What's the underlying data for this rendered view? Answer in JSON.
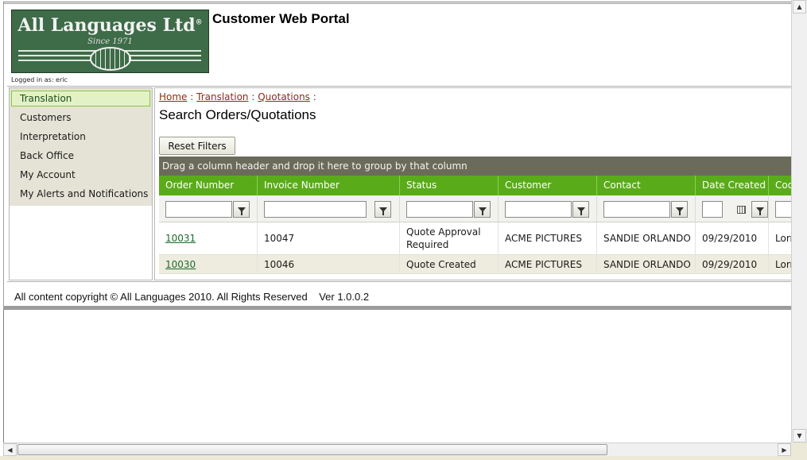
{
  "header": {
    "logo_text": "All Languages Ltd",
    "logo_registered": "®",
    "logo_since": "Since 1971",
    "portal_title": "Customer Web Portal",
    "logged_in": "Logged in as: eric"
  },
  "sidebar": {
    "items": [
      {
        "label": "Translation",
        "active": true
      },
      {
        "label": "Customers"
      },
      {
        "label": "Interpretation"
      },
      {
        "label": "Back Office"
      },
      {
        "label": "My Account"
      },
      {
        "label": "My Alerts and Notifications"
      }
    ]
  },
  "breadcrumb": {
    "items": [
      "Home",
      "Translation",
      "Quotations"
    ],
    "separator": ":"
  },
  "page": {
    "heading": "Search Orders/Quotations",
    "reset_filters": "Reset Filters"
  },
  "grid": {
    "group_panel": "Drag a column header and drop it here to group by that column",
    "columns": [
      "Order Number",
      "Invoice Number",
      "Status",
      "Customer",
      "Contact",
      "Date Created",
      "Coo"
    ],
    "rows": [
      {
        "order": "10031",
        "invoice": "10047",
        "status": "Quote Approval Required",
        "customer": "ACME PICTURES",
        "contact": "SANDIE ORLANDO",
        "date": "09/29/2010",
        "coord": "Lorr"
      },
      {
        "order": "10030",
        "invoice": "10046",
        "status": "Quote Created",
        "customer": "ACME PICTURES",
        "contact": "SANDIE ORLANDO",
        "date": "09/29/2010",
        "coord": "Lorr"
      }
    ]
  },
  "footer": {
    "copyright": "All content copyright © All Languages 2010. All Rights Reserved",
    "version": "Ver 1.0.0.2"
  },
  "icons": {
    "filter": "funnel-icon",
    "calendar": "calendar-icon",
    "scroll_up": "arrow-up-icon",
    "scroll_down": "arrow-down-icon",
    "scroll_left": "arrow-left-icon",
    "scroll_right": "arrow-right-icon"
  },
  "colors": {
    "header_green": "#5aab19",
    "group_panel": "#6b6b5b",
    "sidebar_bg": "#e4e3d6",
    "link_brown": "#8b2c1b",
    "link_green": "#1f6b2a"
  }
}
